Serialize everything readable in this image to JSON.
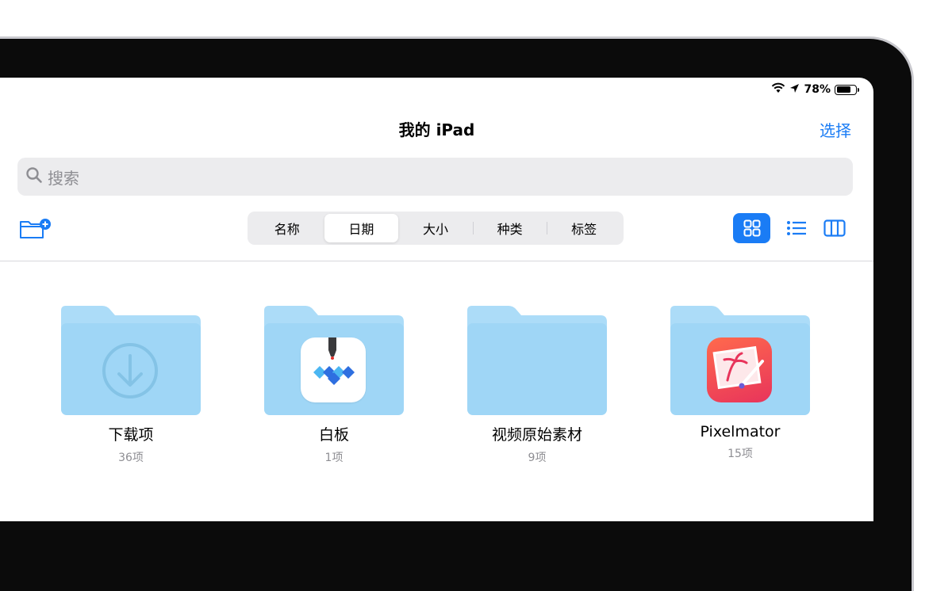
{
  "status": {
    "battery": "78%",
    "battery_level": 0.78
  },
  "nav": {
    "title": "我的 iPad",
    "select_label": "选择"
  },
  "search": {
    "placeholder": "搜索"
  },
  "sort": {
    "options": [
      "名称",
      "日期",
      "大小",
      "种类",
      "标签"
    ],
    "selected": "日期"
  },
  "folders": [
    {
      "name": "下载项",
      "count": "36项",
      "icon": "download-icon"
    },
    {
      "name": "白板",
      "count": "1项",
      "icon": "whiteboard-app-icon"
    },
    {
      "name": "视频原始素材",
      "count": "9项",
      "icon": ""
    },
    {
      "name": "Pixelmator",
      "count": "15项",
      "icon": "pixelmator-app-icon"
    }
  ],
  "colors": {
    "accent": "#1a7cf5",
    "folder": "#9fd6f6",
    "folder_tab": "#acdcf8"
  }
}
